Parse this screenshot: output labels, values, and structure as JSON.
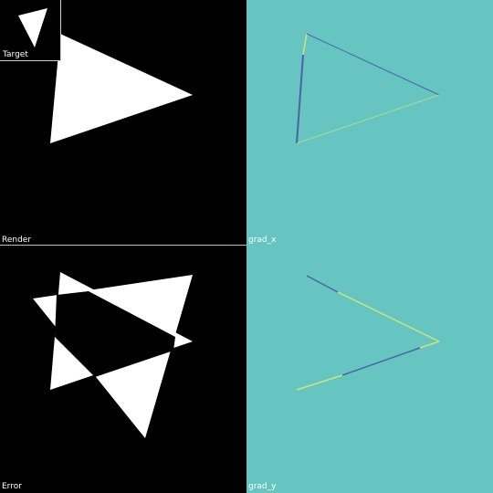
{
  "panels": {
    "render": {
      "label": "Render"
    },
    "target": {
      "label": "Target"
    },
    "grad_x": {
      "label": "grad_x"
    },
    "error": {
      "label": "Error"
    },
    "grad_y": {
      "label": "grad_y"
    }
  },
  "colors": {
    "background": "#000000",
    "shape": "#ffffff",
    "gradient_background": "#66c5c1",
    "gradient_negative": "#4a63a8",
    "gradient_positive": "#c7e87a",
    "divider": "#bcbcbc"
  }
}
